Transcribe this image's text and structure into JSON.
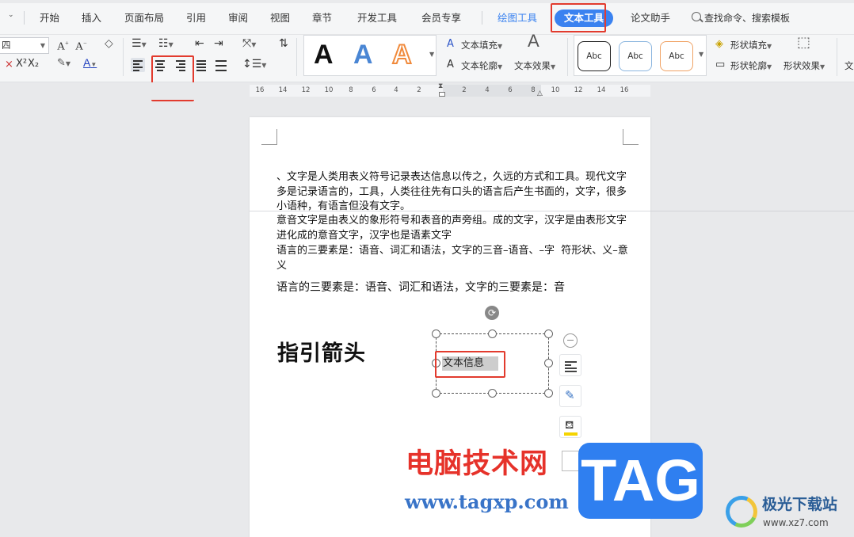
{
  "tabs": [
    {
      "label": "开始"
    },
    {
      "label": "插入"
    },
    {
      "label": "页面布局"
    },
    {
      "label": "引用"
    },
    {
      "label": "审阅"
    },
    {
      "label": "视图"
    },
    {
      "label": "章节"
    },
    {
      "label": "开发工具"
    },
    {
      "label": "会员专享"
    },
    {
      "label": "绘图工具"
    },
    {
      "label": "文本工具"
    },
    {
      "label": "论文助手"
    }
  ],
  "active_tab": "文本工具",
  "search_label": "查找命令、搜索模板",
  "ribbon": {
    "font_size_value": "四",
    "superscript": "X²",
    "subscript": "X₂",
    "text_fill_label": "文本填充",
    "text_outline_label": "文本轮廓",
    "text_effect_label": "文本效果",
    "shape_fill_label": "形状填充",
    "shape_outline_label": "形状轮廓",
    "shape_effect_label": "形状效果",
    "effect_sample_letter": "A",
    "shape_sample_label": "Abc",
    "cut_off_right": "文"
  },
  "colors": {
    "accent": "#3a82f0",
    "highlight_red": "#e23b2e",
    "effect_black": "#111111",
    "effect_blue": "#4a86d4",
    "effect_orange": "#f08a3c"
  },
  "ruler": {
    "numbers": [
      "16",
      "14",
      "12",
      "10",
      "8",
      "6",
      "4",
      "2",
      "2",
      "4",
      "6",
      "8",
      "10",
      "12",
      "14",
      "16"
    ]
  },
  "document": {
    "paragraphs": [
      "、文字是人类用表义符号记录表达信息以传之，久远的方式和工具。现代文字多是记录语言的，工具，人类往往先有口头的语言后产生书面的，文字，很多小语种，有语言但没有文字。",
      "意音文字是由表义的象形符号和表音的声旁组。成的文字，汉字是由表形文字进化成的意音文字，汉字也是语素文字",
      "语言的三要素是：语音、词汇和语法，文字的三音–语音、–字  符形状、义–意义"
    ],
    "line4": "语言的三要素是：语音、词汇和语法，文字的三要素是：音",
    "title": "指引箭头",
    "textbox_text": "文本信息"
  },
  "watermark": {
    "cn_site": "电脑技术网",
    "url": "www.tagxp.com",
    "tag": "TAG",
    "logo_name": "极光下载站",
    "logo_url": "www.xz7.com"
  }
}
